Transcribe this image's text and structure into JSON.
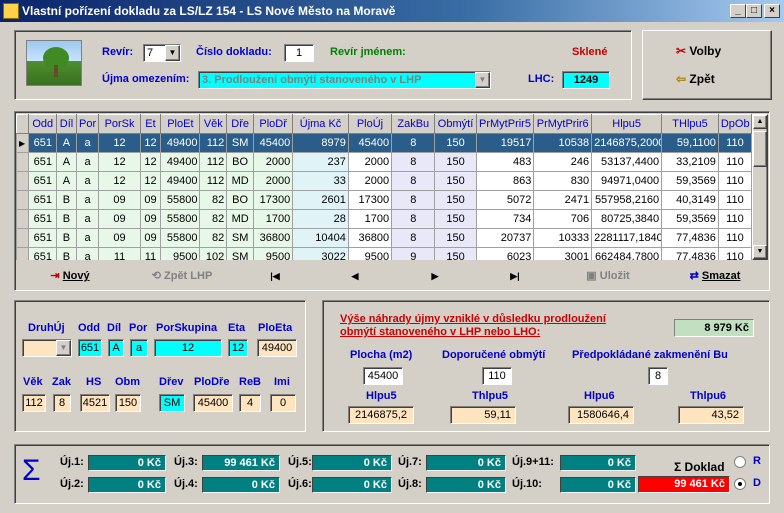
{
  "window": {
    "title": "Vlastní pořízení dokladu za LS/LZ 154 - LS Nové Město na Moravě",
    "min": "_",
    "max": "□",
    "close": "×"
  },
  "header": {
    "revir_label": "Revír:",
    "revir_value": "7",
    "cislo_label": "Číslo dokladu:",
    "cislo_value": "1",
    "revir_jmenem_label": "Revír jménem:",
    "revir_jmenem_value": "Sklené",
    "ujma_label": "Újma omezením:",
    "ujma_value": "3. Prodloužení obmýtí stanoveného v LHP",
    "lhc_label": "LHC:",
    "lhc_value": "1249"
  },
  "buttons": {
    "volby": "Volby",
    "zpet": "Zpět"
  },
  "table": {
    "columns": [
      "Odd",
      "Díl",
      "Por",
      "PorSk",
      "Et",
      "PloEt",
      "Věk",
      "Dře",
      "PloDř",
      "Újma Kč",
      "PloÚj",
      "ZakBu",
      "Obmýtí",
      "PrMytPrir5",
      "PrMytPrir6",
      "Hlpu5",
      "THlpu5",
      "DpOb"
    ],
    "rows": [
      [
        "651",
        "A",
        "a",
        "12",
        "12",
        "49400",
        "112",
        "SM",
        "45400",
        "8979",
        "45400",
        "8",
        "150",
        "19517",
        "10538",
        "2146875,2000",
        "59,1100",
        "110"
      ],
      [
        "651",
        "A",
        "a",
        "12",
        "12",
        "49400",
        "112",
        "BO",
        "2000",
        "237",
        "2000",
        "8",
        "150",
        "483",
        "246",
        "53137,4400",
        "33,2109",
        "110"
      ],
      [
        "651",
        "A",
        "a",
        "12",
        "12",
        "49400",
        "112",
        "MD",
        "2000",
        "33",
        "2000",
        "8",
        "150",
        "863",
        "830",
        "94971,0400",
        "59,3569",
        "110"
      ],
      [
        "651",
        "B",
        "a",
        "09",
        "09",
        "55800",
        "82",
        "BO",
        "17300",
        "2601",
        "17300",
        "8",
        "150",
        "5072",
        "2471",
        "557958,2160",
        "40,3149",
        "110"
      ],
      [
        "651",
        "B",
        "a",
        "09",
        "09",
        "55800",
        "82",
        "MD",
        "1700",
        "28",
        "1700",
        "8",
        "150",
        "734",
        "706",
        "80725,3840",
        "59,3569",
        "110"
      ],
      [
        "651",
        "B",
        "a",
        "09",
        "09",
        "55800",
        "82",
        "SM",
        "36800",
        "10404",
        "36800",
        "8",
        "150",
        "20737",
        "10333",
        "2281117,1840",
        "77,4836",
        "110"
      ],
      [
        "651",
        "B",
        "a",
        "11",
        "11",
        "9500",
        "102",
        "SM",
        "9500",
        "3022",
        "9500",
        "9",
        "150",
        "6023",
        "3001",
        "662484,7800",
        "77,4836",
        "110"
      ]
    ]
  },
  "nav": {
    "novy": "Nový",
    "zpet_lhp": "Zpět LHP",
    "first": "|◀",
    "prev": "◀",
    "next": "▶",
    "last": "▶|",
    "ulozit": "Uložit",
    "smazat": "Smazat"
  },
  "detail": {
    "druhuj_label": "DruhÚj",
    "druhuj_value": "",
    "odd_label": "Odd",
    "odd_value": "651",
    "dil_label": "Díl",
    "dil_value": "A",
    "por_label": "Por",
    "por_value": "a",
    "porskupina_label": "PorSkupina",
    "porskupina_value": "12",
    "eta_label": "Eta",
    "eta_value": "12",
    "ploeta_label": "PloEta",
    "ploeta_value": "49400",
    "vek_label": "Věk",
    "vek_value": "112",
    "zak_label": "Zak",
    "zak_value": "8",
    "hs_label": "HS",
    "hs_value": "4521",
    "obm_label": "Obm",
    "obm_value": "150",
    "drev_label": "Dřev",
    "drev_value": "SM",
    "plodre_label": "PloDře",
    "plodre_value": "45400",
    "reb_label": "ReB",
    "reb_value": "4",
    "imi_label": "Imi",
    "imi_value": "0"
  },
  "nahrada": {
    "title": "Výše náhrady újmy vzniklé v důsledku prodloužení obmýtí stanoveného v LHP nebo LHO:",
    "value": "8 979 Kč",
    "plocha_label": "Plocha (m2)",
    "plocha_value": "45400",
    "doporucene_label": "Doporučené obmýtí",
    "doporucene_value": "110",
    "predpokladane_label": "Předpokládané zakmenění Bu",
    "predpokladane_value": "8",
    "hlpu5_label": "Hlpu5",
    "hlpu5_value": "2146875,2",
    "thlpu5_label": "Thlpu5",
    "thlpu5_value": "59,11",
    "hlpu6_label": "Hlpu6",
    "hlpu6_value": "1580646,4",
    "thlpu6_label": "Thlpu6",
    "thlpu6_value": "43,52"
  },
  "sums": {
    "uj1_label": "Új.1:",
    "uj1": "0 Kč",
    "uj2_label": "Új.2:",
    "uj2": "0 Kč",
    "uj3_label": "Új.3:",
    "uj3": "99 461 Kč",
    "uj4_label": "Új.4:",
    "uj4": "0 Kč",
    "uj5_label": "Új.5:",
    "uj5": "0 Kč",
    "uj6_label": "Új.6:",
    "uj6": "0 Kč",
    "uj7_label": "Új.7:",
    "uj7": "0 Kč",
    "uj8_label": "Új.8:",
    "uj8": "0 Kč",
    "uj911_label": "Új.9+11:",
    "uj911": "0 Kč",
    "uj10_label": "Új.10:",
    "uj10": "0 Kč",
    "doklad_label": "Σ Doklad",
    "doklad_value": "99 461 Kč",
    "radio_r": "R",
    "radio_d": "D"
  }
}
